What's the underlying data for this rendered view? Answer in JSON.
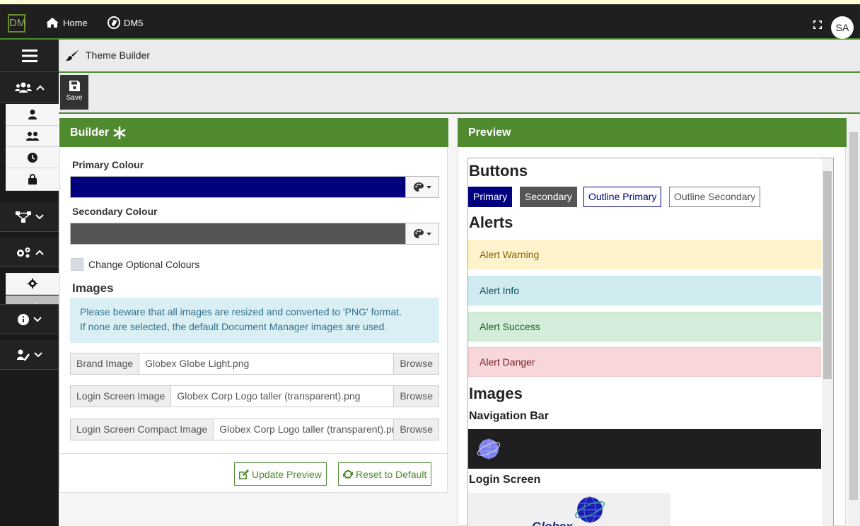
{
  "topbar": {
    "logo_text": "DM",
    "home_label": "Home",
    "site_label": "DM5",
    "avatar_initials": "SA"
  },
  "breadcrumb": {
    "title": "Theme Builder"
  },
  "toolbar": {
    "save_label": "Save"
  },
  "builder": {
    "title": "Builder",
    "primary_label": "Primary Colour",
    "primary_color": "#00007f",
    "secondary_label": "Secondary Colour",
    "secondary_color": "#555555",
    "optional_label": "Change Optional Colours",
    "images_heading": "Images",
    "note_line1": "Please beware that all images are resized and converted to 'PNG' format.",
    "note_line2": "If none are selected, the default Document Manager images are used.",
    "files": [
      {
        "caption": "Brand Image",
        "value": "Globex Globe Light.png",
        "button": "Browse"
      },
      {
        "caption": "Login Screen Image",
        "value": "Globex Corp Logo taller (transparent).png",
        "button": "Browse"
      },
      {
        "caption": "Login Screen Compact Image",
        "value": "Globex Corp Logo taller (transparent).png",
        "button": "Browse"
      }
    ],
    "update_label": "Update Preview",
    "reset_label": "Reset to Default"
  },
  "preview": {
    "title": "Preview",
    "buttons_heading": "Buttons",
    "buttons": [
      "Primary",
      "Secondary",
      "Outline Primary",
      "Outline Secondary"
    ],
    "alerts_heading": "Alerts",
    "alerts": [
      "Alert Warning",
      "Alert Info",
      "Alert Success",
      "Alert Danger"
    ],
    "images_heading": "Images",
    "navbar_label": "Navigation Bar",
    "login_label": "Login Screen",
    "login_logo_text": "Globex"
  },
  "colors": {
    "accent_green": "#4f8a2e",
    "primary": "#00007f",
    "secondary": "#555555"
  }
}
